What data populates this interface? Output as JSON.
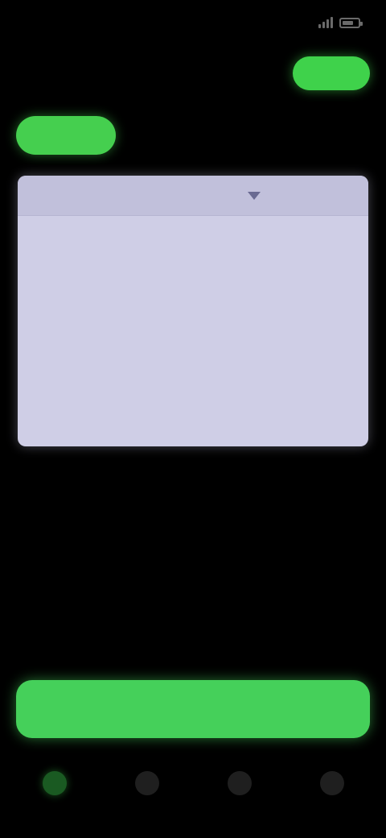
{
  "status_bar": {
    "time": "",
    "indicators": [
      "signal-icon",
      "battery-icon"
    ]
  },
  "header": {
    "title": "",
    "action_label": ""
  },
  "tabs": [
    {
      "label": "",
      "active": true
    },
    {
      "label": "",
      "active": false
    }
  ],
  "card": {
    "select_value": "",
    "meta": "",
    "body_text": "",
    "footer_text": ""
  },
  "primary_action": {
    "label": ""
  },
  "bottom_nav": [
    {
      "icon": "home-icon",
      "label": "",
      "active": true
    },
    {
      "icon": "list-icon",
      "label": "",
      "active": false
    },
    {
      "icon": "chart-icon",
      "label": "",
      "active": false
    },
    {
      "icon": "profile-icon",
      "label": "",
      "active": false
    }
  ],
  "colors": {
    "background": "#000000",
    "accent": "#45cf4f",
    "card": "#cfcee6",
    "muted_text": "#8a8a8a"
  }
}
